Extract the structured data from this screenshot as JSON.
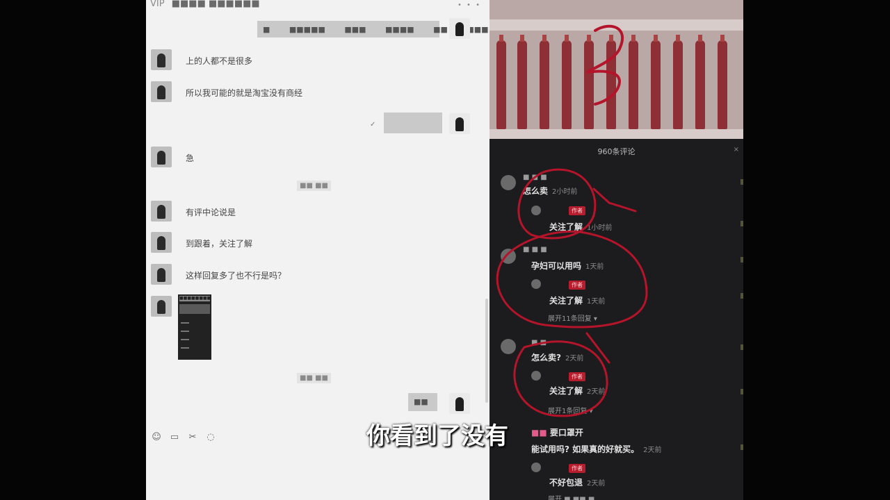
{
  "chat": {
    "title_vip": "VIP",
    "title": "■■■■ ■■■■■■",
    "window_controls": "• • •",
    "top_bubble": "■ ■■■■■ ■■■ ■■■■ ■■ ■■■",
    "messages": [
      {
        "text": "上的人都不是很多"
      },
      {
        "text": "所以我可能的就是淘宝没有商经"
      },
      {
        "text": "急"
      },
      {
        "text": "有评中论说是"
      },
      {
        "text": "到跟着，关注了解"
      },
      {
        "text": "这样回复多了也不行是吗？"
      }
    ],
    "my_bubble_2": "",
    "my_bubble_3": "■■",
    "read_mark": "✓",
    "timestamps": [
      "■■ ■■",
      "■■ ■■"
    ],
    "image_msg_strip": "■■■■■■■■■■"
  },
  "comments": {
    "header": "960条评论",
    "close": "×",
    "items": [
      {
        "name": "■ ■ ■",
        "text": "怎么卖",
        "time": "2小时前",
        "reply_badge": "作者",
        "reply_text": "关注了解",
        "reply_time": "1小时前"
      },
      {
        "name": "■ ■ ■",
        "text": "孕妇可以用吗",
        "time": "1天前",
        "reply_badge": "作者",
        "reply_text": "关注了解",
        "reply_time": "1天前",
        "expand": "展开11条回复 ▾"
      },
      {
        "name": "■ ■",
        "text": "怎么卖?",
        "time": "2天前",
        "reply_badge": "作者",
        "reply_text": "关注了解",
        "reply_time": "2天前",
        "expand": "展开1条回复 ▾"
      },
      {
        "name": "■■",
        "text_pre": "■■ ",
        "text_mid": "要口罩开",
        "line2": "能试用吗? 如果真的好就买。",
        "time": "2天前",
        "reply_badge": "作者",
        "reply_text": "不好包退",
        "reply_time": "2天前",
        "expand": "展开 ■ ■■ ■"
      }
    ]
  },
  "subtitle": "你看到了没有",
  "colors": {
    "annotation": "#b4152a",
    "badge": "#b81d2e"
  }
}
